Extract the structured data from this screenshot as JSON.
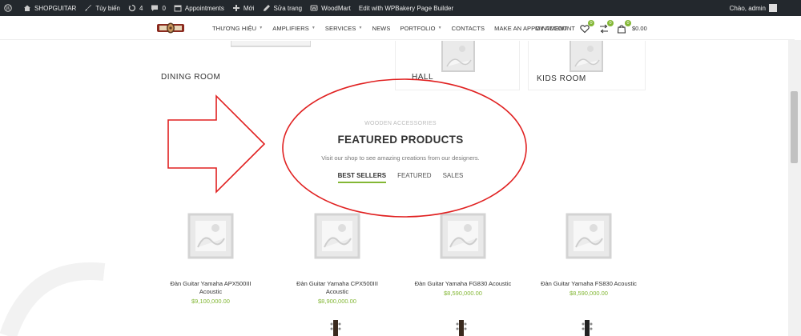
{
  "admin_bar": {
    "site_name": "SHOPGUITAR",
    "customize": "Tùy biến",
    "updates_count": "4",
    "comments_count": "0",
    "appointments": "Appointments",
    "new": "Mới",
    "edit_page": "Sửa trang",
    "woodmart": "WoodMart",
    "wpbakery": "Edit with WPBakery Page Builder",
    "greeting": "Chào, admin"
  },
  "header": {
    "nav": [
      "THƯƠNG HIỆU",
      "AMPLIFIERS",
      "SERVICES",
      "NEWS",
      "PORTFOLIO",
      "CONTACTS",
      "MAKE AN APPOINTMENT"
    ],
    "nav_has_dropdown": [
      true,
      true,
      true,
      false,
      true,
      false,
      false
    ],
    "account": "MY ACCOUNT",
    "wishlist_count": "0",
    "compare_count": "0",
    "cart_count": "0",
    "cart_total": "$0.00"
  },
  "categories": [
    {
      "label": "DINING ROOM"
    },
    {
      "label": "HALL"
    },
    {
      "label": "KIDS ROOM"
    }
  ],
  "featured": {
    "subtitle": "WOODEN ACCESSORIES",
    "title": "FEATURED PRODUCTS",
    "description": "Visit our shop to see amazing creations from our designers.",
    "tabs": [
      {
        "label": "BEST SELLERS",
        "active": true
      },
      {
        "label": "FEATURED",
        "active": false
      },
      {
        "label": "SALES",
        "active": false
      }
    ]
  },
  "products": [
    {
      "name_line1": "Đàn Guitar Yamaha APX500III",
      "name_line2": "Acoustic",
      "price": "$9,100,000.00"
    },
    {
      "name_line1": "Đàn Guitar Yamaha CPX500III",
      "name_line2": "Acoustic",
      "price": "$8,900,000.00"
    },
    {
      "name_line1": "Đàn Guitar Yamaha FG830 Acoustic",
      "name_line2": "",
      "price": "$8,590,000.00"
    },
    {
      "name_line1": "Đàn Guitar Yamaha FS830 Acoustic",
      "name_line2": "",
      "price": "$8,590,000.00"
    }
  ],
  "colors": {
    "accent": "#83b735",
    "annotation": "#e02020",
    "admin_bar": "#23282d"
  }
}
